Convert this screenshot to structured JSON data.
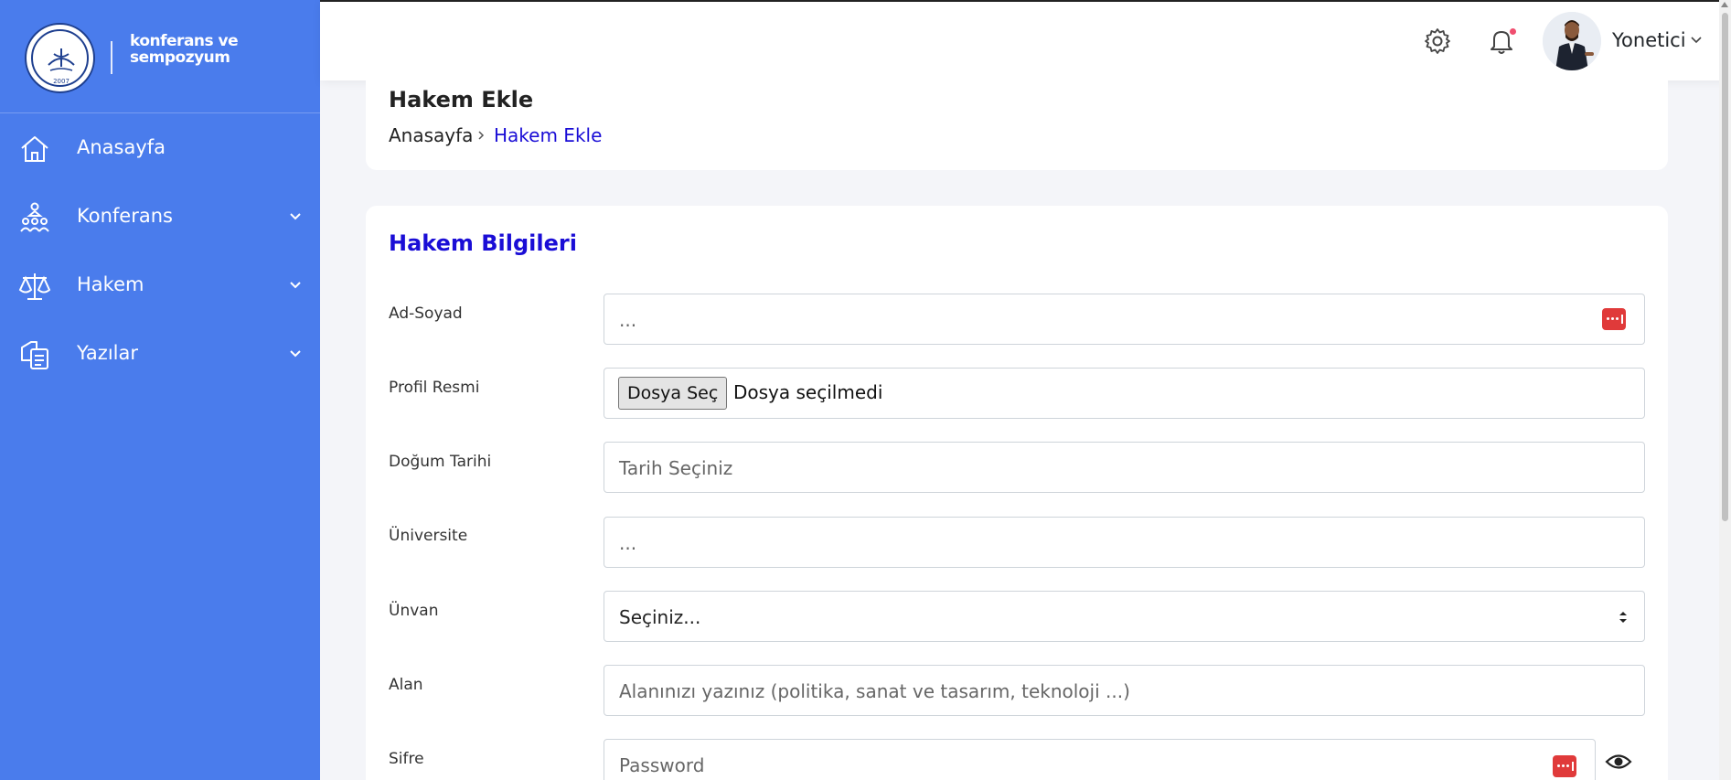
{
  "sidebar": {
    "logo_text": "konferans ve sempozyum",
    "seal_text": "KIRKLARELİ ÜNİVERSİTESİ",
    "seal_year": "2007",
    "items": [
      {
        "label": "Anasayfa",
        "icon": "home-icon",
        "expandable": false
      },
      {
        "label": "Konferans",
        "icon": "conference-icon",
        "expandable": true
      },
      {
        "label": "Hakem",
        "icon": "scales-icon",
        "expandable": true
      },
      {
        "label": "Yazılar",
        "icon": "documents-icon",
        "expandable": true
      }
    ]
  },
  "topbar": {
    "user_name": "Yonetici",
    "icons": [
      "gear-icon",
      "bell-icon"
    ]
  },
  "page": {
    "title": "Hakem Ekle",
    "breadcrumb": {
      "home": "Anasayfa",
      "current": "Hakem Ekle"
    }
  },
  "form": {
    "section_title": "Hakem Bilgileri",
    "fields": {
      "name": {
        "label": "Ad-Soyad",
        "placeholder": "..."
      },
      "photo": {
        "label": "Profil Resmi",
        "button": "Dosya Seç",
        "status": "Dosya seçilmedi"
      },
      "birth": {
        "label": "Doğum Tarihi",
        "placeholder": "Tarih Seçiniz"
      },
      "university": {
        "label": "Üniversite",
        "placeholder": "..."
      },
      "title": {
        "label": "Ünvan",
        "value": "Seçiniz..."
      },
      "field": {
        "label": "Alan",
        "placeholder": "Alanınızı yazınız (politika, sanat ve tasarım, teknoloji ...)"
      },
      "password": {
        "label": "Sifre",
        "placeholder": "Password"
      }
    }
  },
  "colors": {
    "sidebar": "#4a7cec",
    "accent": "#1a0dd6",
    "keypass": "#e03a3a",
    "notification": "#f04e6f"
  }
}
